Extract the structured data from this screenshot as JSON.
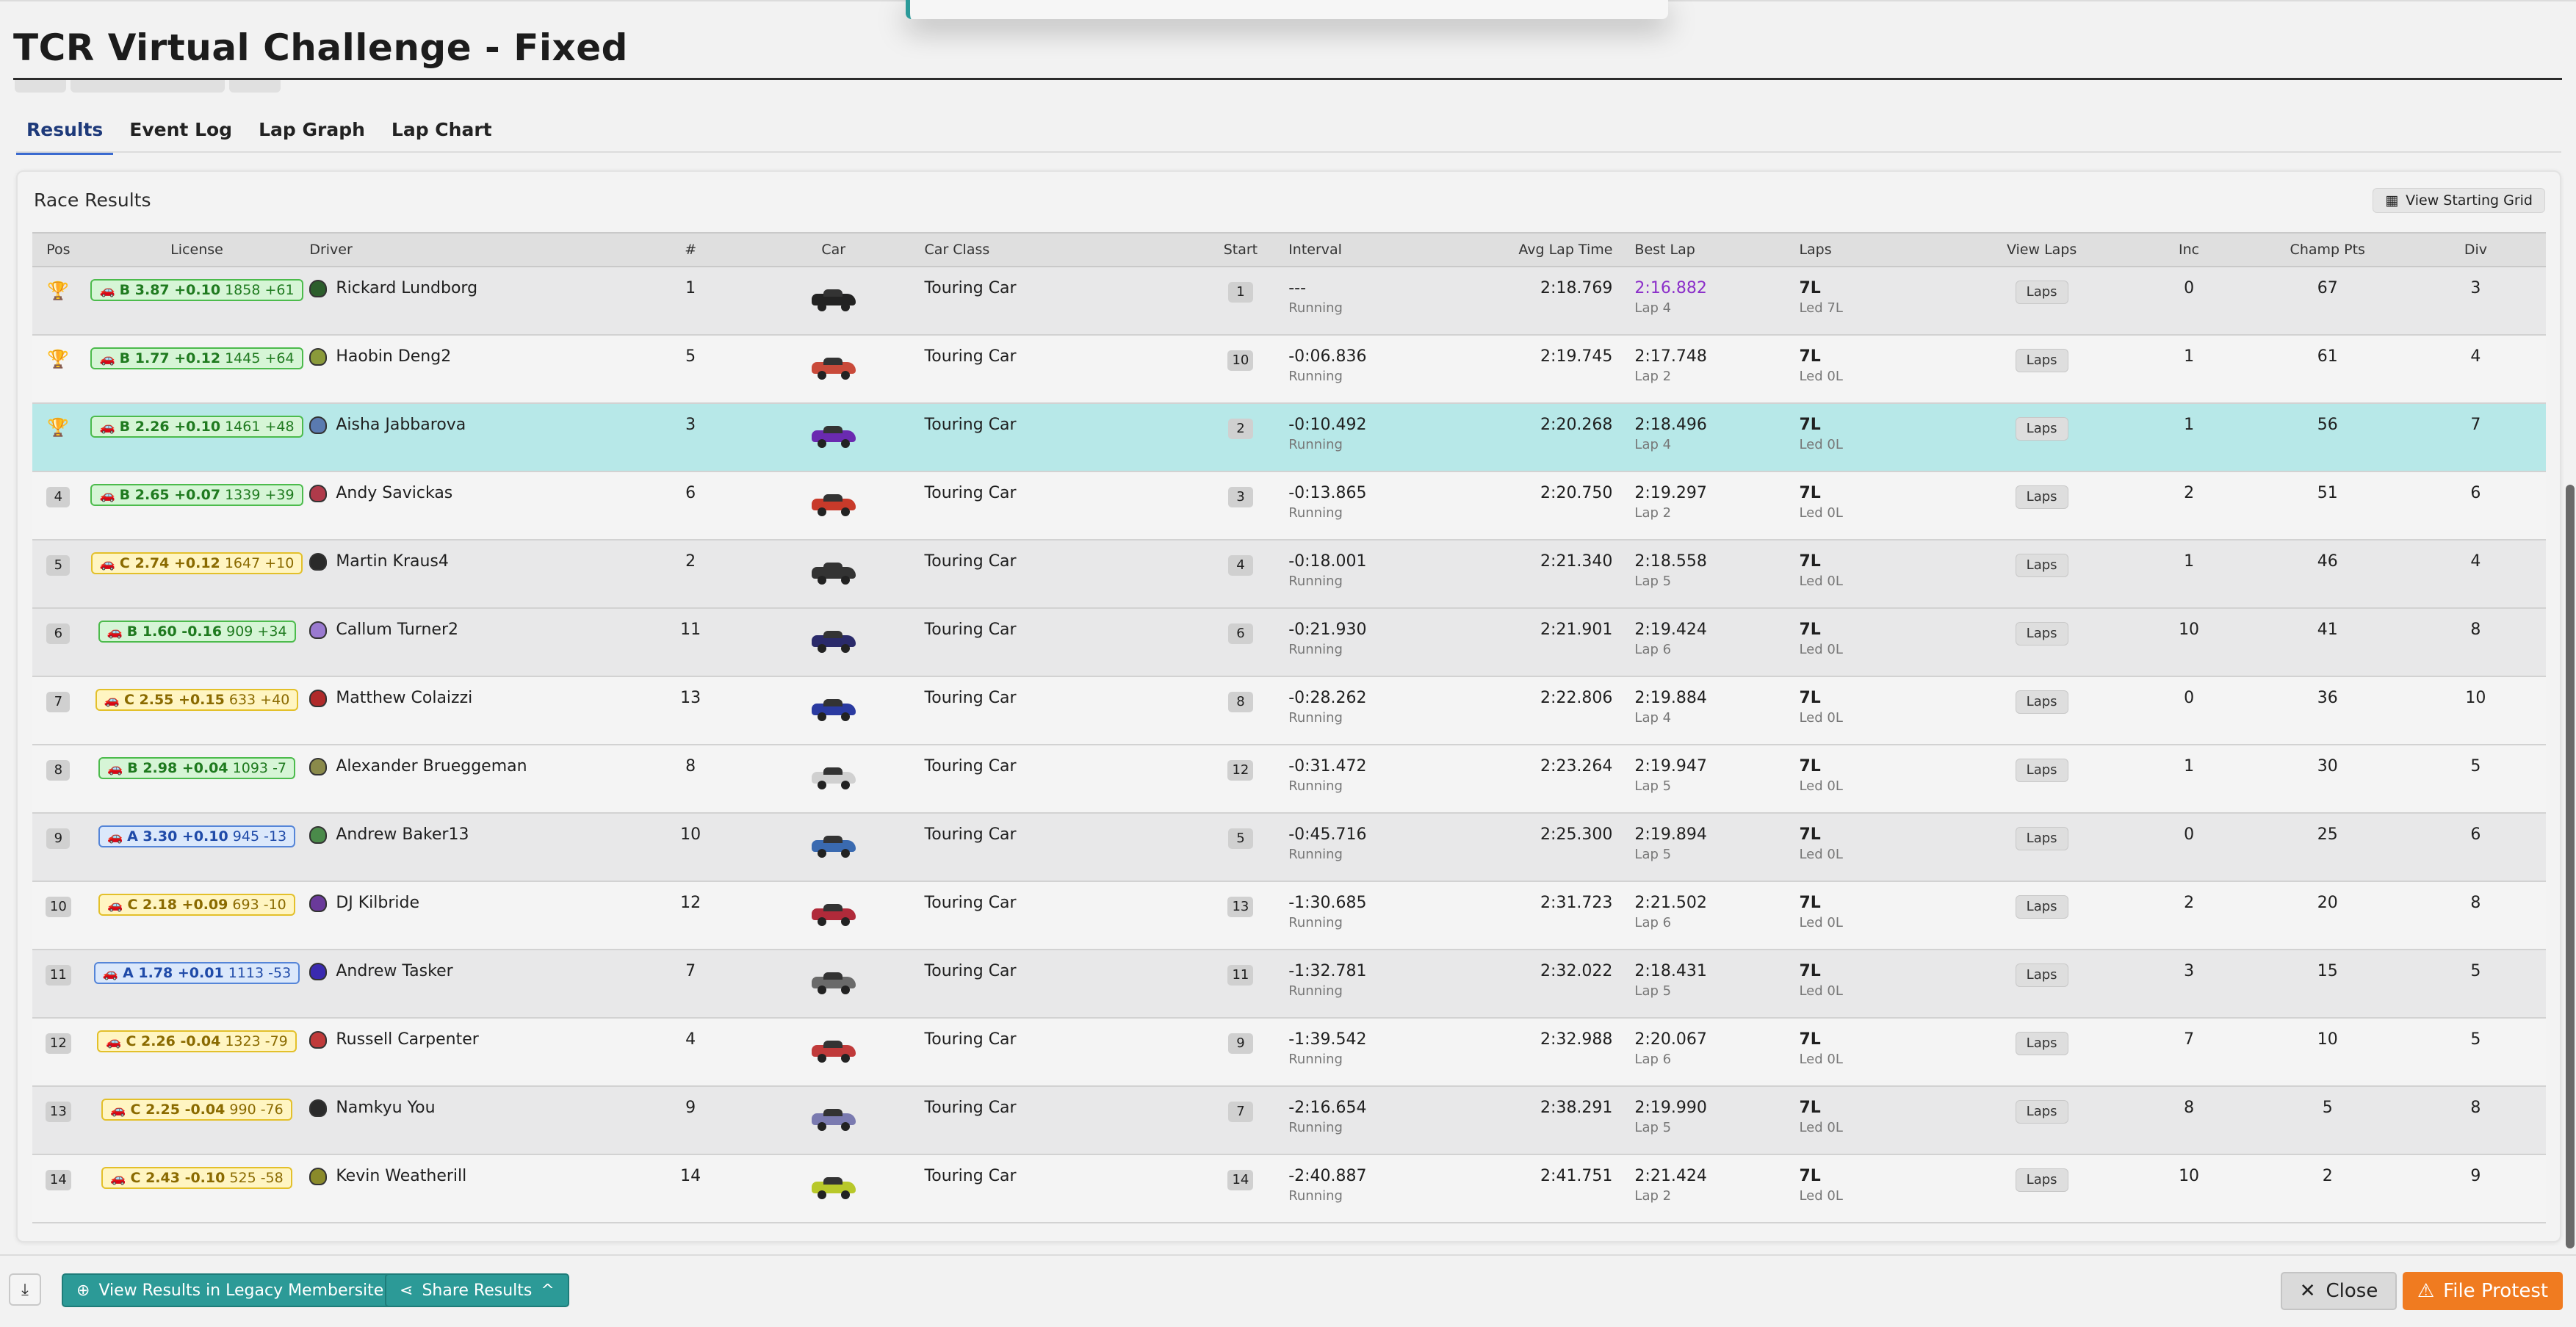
{
  "page": {
    "title": "TCR Virtual Challenge - Fixed"
  },
  "tabs": [
    {
      "label": "Results",
      "active": true
    },
    {
      "label": "Event Log",
      "active": false
    },
    {
      "label": "Lap Graph",
      "active": false
    },
    {
      "label": "Lap Chart",
      "active": false
    }
  ],
  "panel": {
    "title": "Race Results",
    "grid_button": "View Starting Grid"
  },
  "columns": {
    "pos": "Pos",
    "license": "License",
    "driver": "Driver",
    "num": "#",
    "car": "Car",
    "car_class": "Car Class",
    "start": "Start",
    "interval": "Interval",
    "avg": "Avg Lap Time",
    "best": "Best Lap",
    "laps": "Laps",
    "view_laps": "View Laps",
    "inc": "Inc",
    "champ": "Champ Pts",
    "div": "Div"
  },
  "laps_button": "Laps",
  "rows": [
    {
      "pos": "1",
      "trophy": "gold",
      "lic_class": "B",
      "lic_main": "B 3.87 +0.10",
      "lic_extra": "1858 +61",
      "driver": "Rickard Lundborg",
      "helmet": "#2c5e2c",
      "num": "1",
      "car_color": "#222",
      "car_class": "Touring Car",
      "start": "1",
      "interval": "---",
      "status": "Running",
      "avg": "2:18.769",
      "best": "2:16.882",
      "best_lap": "Lap 4",
      "best_purple": true,
      "laps": "7L",
      "led": "Led 7L",
      "inc": "0",
      "champ": "67",
      "div": "3",
      "style": "alt"
    },
    {
      "pos": "2",
      "trophy": "silver",
      "lic_class": "B",
      "lic_main": "B 1.77 +0.12",
      "lic_extra": "1445 +64",
      "driver": "Haobin Deng2",
      "helmet": "#8a9a3a",
      "num": "5",
      "car_color": "#c94a3a",
      "car_class": "Touring Car",
      "start": "10",
      "interval": "-0:06.836",
      "status": "Running",
      "avg": "2:19.745",
      "best": "2:17.748",
      "best_lap": "Lap 2",
      "best_purple": false,
      "laps": "7L",
      "led": "Led 0L",
      "inc": "1",
      "champ": "61",
      "div": "4",
      "style": "plain"
    },
    {
      "pos": "3",
      "trophy": "bronze",
      "lic_class": "B",
      "lic_main": "B 2.26 +0.10",
      "lic_extra": "1461 +48",
      "driver": "Aisha Jabbarova",
      "helmet": "#5a7ab0",
      "num": "3",
      "car_color": "#6a2ab0",
      "car_class": "Touring Car",
      "start": "2",
      "interval": "-0:10.492",
      "status": "Running",
      "avg": "2:20.268",
      "best": "2:18.496",
      "best_lap": "Lap 4",
      "best_purple": false,
      "laps": "7L",
      "led": "Led 0L",
      "inc": "1",
      "champ": "56",
      "div": "7",
      "style": "hl"
    },
    {
      "pos": "4",
      "trophy": "",
      "lic_class": "B",
      "lic_main": "B 2.65 +0.07",
      "lic_extra": "1339 +39",
      "driver": "Andy Savickas",
      "helmet": "#b03a4a",
      "num": "6",
      "car_color": "#c83a2a",
      "car_class": "Touring Car",
      "start": "3",
      "interval": "-0:13.865",
      "status": "Running",
      "avg": "2:20.750",
      "best": "2:19.297",
      "best_lap": "Lap 2",
      "best_purple": false,
      "laps": "7L",
      "led": "Led 0L",
      "inc": "2",
      "champ": "51",
      "div": "6",
      "style": "plain"
    },
    {
      "pos": "5",
      "trophy": "",
      "lic_class": "C",
      "lic_main": "C 2.74 +0.12",
      "lic_extra": "1647 +10",
      "driver": "Martin Kraus4",
      "helmet": "#2a2a2a",
      "num": "2",
      "car_color": "#333",
      "car_class": "Touring Car",
      "start": "4",
      "interval": "-0:18.001",
      "status": "Running",
      "avg": "2:21.340",
      "best": "2:18.558",
      "best_lap": "Lap 5",
      "best_purple": false,
      "laps": "7L",
      "led": "Led 0L",
      "inc": "1",
      "champ": "46",
      "div": "4",
      "style": "alt"
    },
    {
      "pos": "6",
      "trophy": "",
      "lic_class": "B",
      "lic_main": "B 1.60 -0.16",
      "lic_extra": "909 +34",
      "driver": "Callum Turner2",
      "helmet": "#9a7ad0",
      "num": "11",
      "car_color": "#2a2a6a",
      "car_class": "Touring Car",
      "start": "6",
      "interval": "-0:21.930",
      "status": "Running",
      "avg": "2:21.901",
      "best": "2:19.424",
      "best_lap": "Lap 6",
      "best_purple": false,
      "laps": "7L",
      "led": "Led 0L",
      "inc": "10",
      "champ": "41",
      "div": "8",
      "style": "alt"
    },
    {
      "pos": "7",
      "trophy": "",
      "lic_class": "C",
      "lic_main": "C 2.55 +0.15",
      "lic_extra": "633 +40",
      "driver": "Matthew Colaizzi",
      "helmet": "#b02a2a",
      "num": "13",
      "car_color": "#2a3aa0",
      "car_class": "Touring Car",
      "start": "8",
      "interval": "-0:28.262",
      "status": "Running",
      "avg": "2:22.806",
      "best": "2:19.884",
      "best_lap": "Lap 4",
      "best_purple": false,
      "laps": "7L",
      "led": "Led 0L",
      "inc": "0",
      "champ": "36",
      "div": "10",
      "style": "plain"
    },
    {
      "pos": "8",
      "trophy": "",
      "lic_class": "B",
      "lic_main": "B 2.98 +0.04",
      "lic_extra": "1093 -7",
      "driver": "Alexander Brueggeman",
      "helmet": "#8a8a4a",
      "num": "8",
      "car_color": "#d0d0d0",
      "car_class": "Touring Car",
      "start": "12",
      "interval": "-0:31.472",
      "status": "Running",
      "avg": "2:23.264",
      "best": "2:19.947",
      "best_lap": "Lap 5",
      "best_purple": false,
      "laps": "7L",
      "led": "Led 0L",
      "inc": "1",
      "champ": "30",
      "div": "5",
      "style": "plain"
    },
    {
      "pos": "9",
      "trophy": "",
      "lic_class": "A",
      "lic_main": "A 3.30 +0.10",
      "lic_extra": "945 -13",
      "driver": "Andrew Baker13",
      "helmet": "#4a8a4a",
      "num": "10",
      "car_color": "#3a6ab0",
      "car_class": "Touring Car",
      "start": "5",
      "interval": "-0:45.716",
      "status": "Running",
      "avg": "2:25.300",
      "best": "2:19.894",
      "best_lap": "Lap 5",
      "best_purple": false,
      "laps": "7L",
      "led": "Led 0L",
      "inc": "0",
      "champ": "25",
      "div": "6",
      "style": "alt"
    },
    {
      "pos": "10",
      "trophy": "",
      "lic_class": "C",
      "lic_main": "C 2.18 +0.09",
      "lic_extra": "693 -10",
      "driver": "DJ Kilbride",
      "helmet": "#6a3a9a",
      "num": "12",
      "car_color": "#b02a3a",
      "car_class": "Touring Car",
      "start": "13",
      "interval": "-1:30.685",
      "status": "Running",
      "avg": "2:31.723",
      "best": "2:21.502",
      "best_lap": "Lap 6",
      "best_purple": false,
      "laps": "7L",
      "led": "Led 0L",
      "inc": "2",
      "champ": "20",
      "div": "8",
      "style": "plain"
    },
    {
      "pos": "11",
      "trophy": "",
      "lic_class": "A",
      "lic_main": "A 1.78 +0.01",
      "lic_extra": "1113 -53",
      "driver": "Andrew Tasker",
      "helmet": "#3a2ab0",
      "num": "7",
      "car_color": "#6a6a6a",
      "car_class": "Touring Car",
      "start": "11",
      "interval": "-1:32.781",
      "status": "Running",
      "avg": "2:32.022",
      "best": "2:18.431",
      "best_lap": "Lap 5",
      "best_purple": false,
      "laps": "7L",
      "led": "Led 0L",
      "inc": "3",
      "champ": "15",
      "div": "5",
      "style": "alt"
    },
    {
      "pos": "12",
      "trophy": "",
      "lic_class": "C",
      "lic_main": "C 2.26 -0.04",
      "lic_extra": "1323 -79",
      "driver": "Russell Carpenter",
      "helmet": "#c03a3a",
      "num": "4",
      "car_color": "#c03a3a",
      "car_class": "Touring Car",
      "start": "9",
      "interval": "-1:39.542",
      "status": "Running",
      "avg": "2:32.988",
      "best": "2:20.067",
      "best_lap": "Lap 6",
      "best_purple": false,
      "laps": "7L",
      "led": "Led 0L",
      "inc": "7",
      "champ": "10",
      "div": "5",
      "style": "plain"
    },
    {
      "pos": "13",
      "trophy": "",
      "lic_class": "C",
      "lic_main": "C 2.25 -0.04",
      "lic_extra": "990 -76",
      "driver": "Namkyu You",
      "helmet": "#2a2a2a",
      "num": "9",
      "car_color": "#7a7ab0",
      "car_class": "Touring Car",
      "start": "7",
      "interval": "-2:16.654",
      "status": "Running",
      "avg": "2:38.291",
      "best": "2:19.990",
      "best_lap": "Lap 5",
      "best_purple": false,
      "laps": "7L",
      "led": "Led 0L",
      "inc": "8",
      "champ": "5",
      "div": "8",
      "style": "alt"
    },
    {
      "pos": "14",
      "trophy": "",
      "lic_class": "C",
      "lic_main": "C 2.43 -0.10",
      "lic_extra": "525 -58",
      "driver": "Kevin Weatherill",
      "helmet": "#8a8a2a",
      "num": "14",
      "car_color": "#b8c82a",
      "car_class": "Touring Car",
      "start": "14",
      "interval": "-2:40.887",
      "status": "Running",
      "avg": "2:41.751",
      "best": "2:21.424",
      "best_lap": "Lap 2",
      "best_purple": false,
      "laps": "7L",
      "led": "Led 0L",
      "inc": "10",
      "champ": "2",
      "div": "9",
      "style": "plain"
    }
  ],
  "footer": {
    "legacy_button": "View Results in Legacy Membersite",
    "share_button": "Share Results",
    "close_button": "Close",
    "protest_button": "File Protest"
  },
  "colors": {
    "accent_teal": "#2c9a97",
    "protest_orange": "#f07b20",
    "highlight_row": "#b7e8e8",
    "fastest_lap_purple": "#8b2fc9"
  }
}
